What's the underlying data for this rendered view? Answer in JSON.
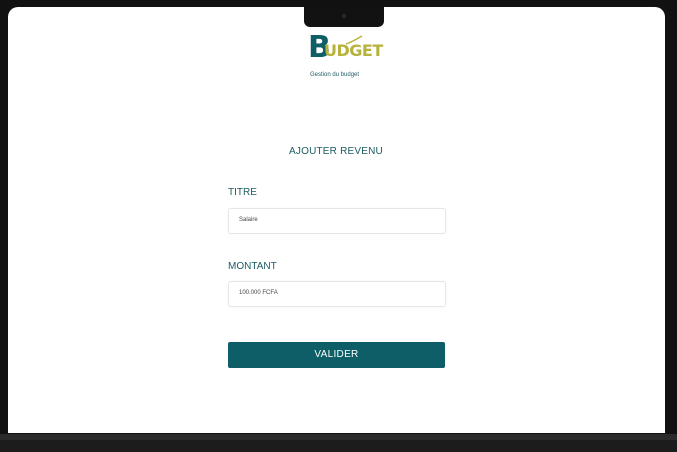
{
  "brand": {
    "logo_first_letter": "B",
    "logo_rest": "UDGET",
    "tagline": "Gestion du budget",
    "primary_color": "#0e5e66",
    "accent_color": "#b7b33a"
  },
  "form": {
    "title": "AJOUTER REVENU",
    "fields": [
      {
        "label": "TITRE",
        "value": "Salaire"
      },
      {
        "label": "MONTANT",
        "value": "100.000 FCFA"
      }
    ],
    "submit_label": "VALIDER"
  }
}
